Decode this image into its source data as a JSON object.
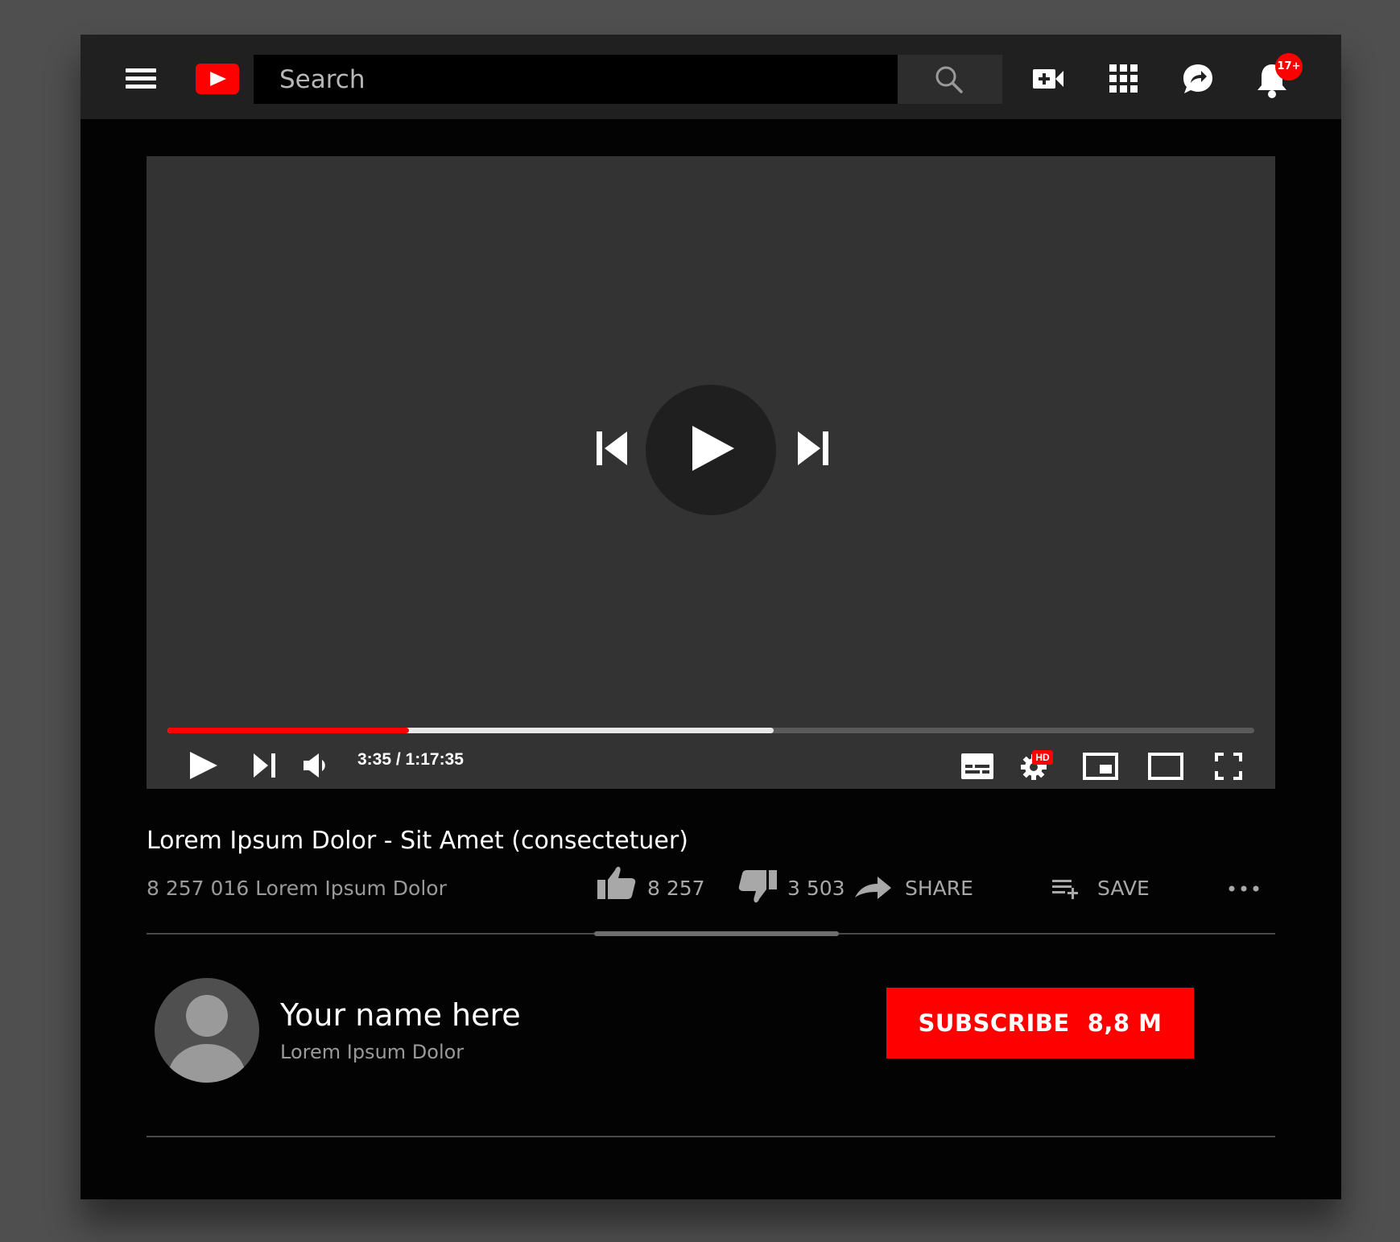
{
  "header": {
    "search_placeholder": "Search",
    "notification_count": "17+",
    "icons": [
      "hamburger-menu-icon",
      "youtube-logo",
      "search-icon",
      "create-video-icon",
      "apps-grid-icon",
      "messages-icon",
      "bell-icon"
    ]
  },
  "player": {
    "current_time": "3:35",
    "duration": "1:17:35",
    "time_display": "3:35 / 1:17:35",
    "played_fraction": 0.222,
    "buffered_fraction": 0.558,
    "quality_badge": "HD"
  },
  "video": {
    "title": "Lorem Ipsum Dolor - Sit Amet (consectetuer)",
    "views": "8 257 016 Lorem Ipsum Dolor",
    "likes": "8 257",
    "dislikes": "3 503",
    "share_label": "SHARE",
    "save_label": "SAVE"
  },
  "channel": {
    "name": "Your name here",
    "subtitle": "Lorem Ipsum Dolor",
    "subscribe_label": "SUBSCRIBE",
    "subscriber_count": "8,8 M"
  },
  "colors": {
    "brand_red": "#ff0000",
    "topbar": "#202020",
    "page_bg": "#030303",
    "player_bg": "#333333"
  }
}
